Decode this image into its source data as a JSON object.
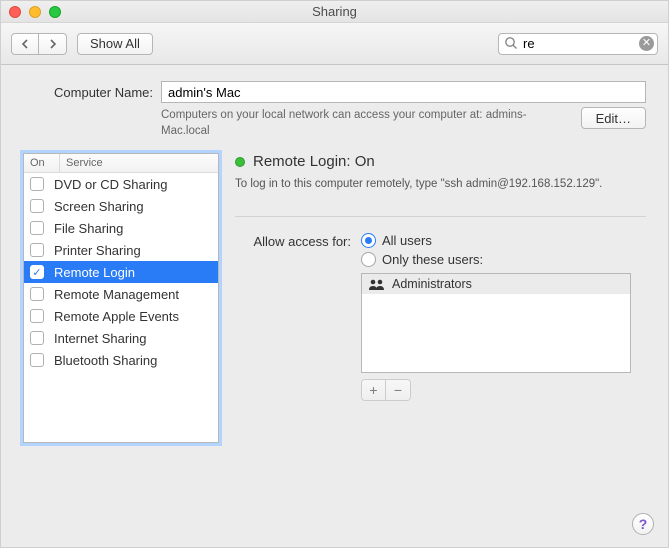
{
  "window": {
    "title": "Sharing"
  },
  "toolbar": {
    "show_all": "Show All",
    "search_value": "re"
  },
  "computer_name": {
    "label": "Computer Name:",
    "value": "admin's Mac",
    "host_text": "Computers on your local network can access your computer at: admins-Mac.local",
    "edit_label": "Edit…"
  },
  "services": {
    "columns": {
      "on": "On",
      "service": "Service"
    },
    "items": [
      {
        "label": "DVD or CD Sharing",
        "checked": false,
        "selected": false
      },
      {
        "label": "Screen Sharing",
        "checked": false,
        "selected": false
      },
      {
        "label": "File Sharing",
        "checked": false,
        "selected": false
      },
      {
        "label": "Printer Sharing",
        "checked": false,
        "selected": false
      },
      {
        "label": "Remote Login",
        "checked": true,
        "selected": true
      },
      {
        "label": "Remote Management",
        "checked": false,
        "selected": false
      },
      {
        "label": "Remote Apple Events",
        "checked": false,
        "selected": false
      },
      {
        "label": "Internet Sharing",
        "checked": false,
        "selected": false
      },
      {
        "label": "Bluetooth Sharing",
        "checked": false,
        "selected": false
      }
    ]
  },
  "status": {
    "title": "Remote Login: On",
    "instruction": "To log in to this computer remotely, type \"ssh admin@192.168.152.129\"."
  },
  "access": {
    "label": "Allow access for:",
    "options": {
      "all": "All users",
      "only": "Only these users:"
    },
    "selected": "all",
    "users": [
      {
        "label": "Administrators"
      }
    ]
  },
  "buttons": {
    "add": "+",
    "remove": "−",
    "help": "?"
  }
}
